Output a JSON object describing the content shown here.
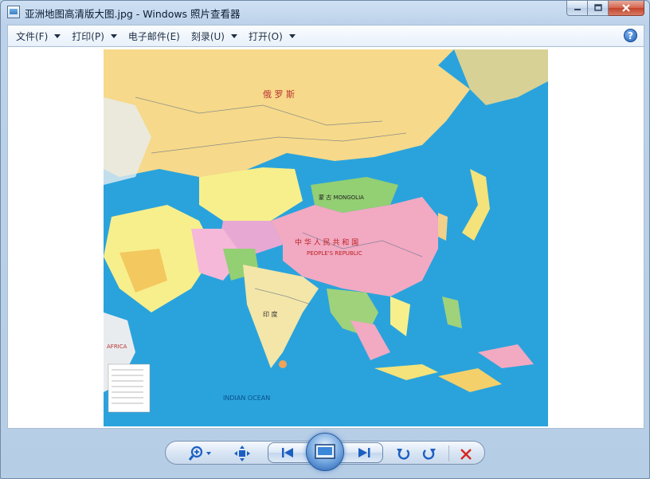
{
  "window": {
    "title": "亚洲地图高清版大图.jpg - Windows 照片查看器",
    "icon": "photo-viewer-icon",
    "controls": {
      "minimize": "minimize-icon",
      "maximize": "maximize-icon",
      "close": "close-icon"
    }
  },
  "menu": {
    "items": [
      {
        "label": "文件(F)"
      },
      {
        "label": "打印(P)"
      },
      {
        "label": "电子邮件(E)"
      },
      {
        "label": "刻录(U)"
      },
      {
        "label": "打开(O)"
      }
    ],
    "help_label": "?"
  },
  "photo": {
    "description_icon": "asia-map-image",
    "labels": {
      "russia": "俄 罗 斯",
      "mongolia": "蒙 古 MONGOLIA",
      "china": "中 华 人 民 共 和 国",
      "china_en": "PEOPLE'S REPUBLIC",
      "india": "印 度",
      "indian_ocean": "INDIAN OCEAN",
      "africa": "AFRICA"
    }
  },
  "toolbar": {
    "zoom": "zoom-icon",
    "actual_size": "actual-size-icon",
    "previous": "previous-icon",
    "slideshow": "slideshow-icon",
    "next": "next-icon",
    "rotate_ccw": "rotate-counterclockwise-icon",
    "rotate_cw": "rotate-clockwise-icon",
    "delete": "delete-icon"
  },
  "colors": {
    "ocean": "#2aa3dc",
    "land_russia": "#f6d98a",
    "land_china": "#f2a9c2",
    "land_mongolia": "#93cf73",
    "land_india": "#f3e6a8",
    "accent_blue": "#1c5fc2",
    "delete_red": "#d8261f"
  }
}
